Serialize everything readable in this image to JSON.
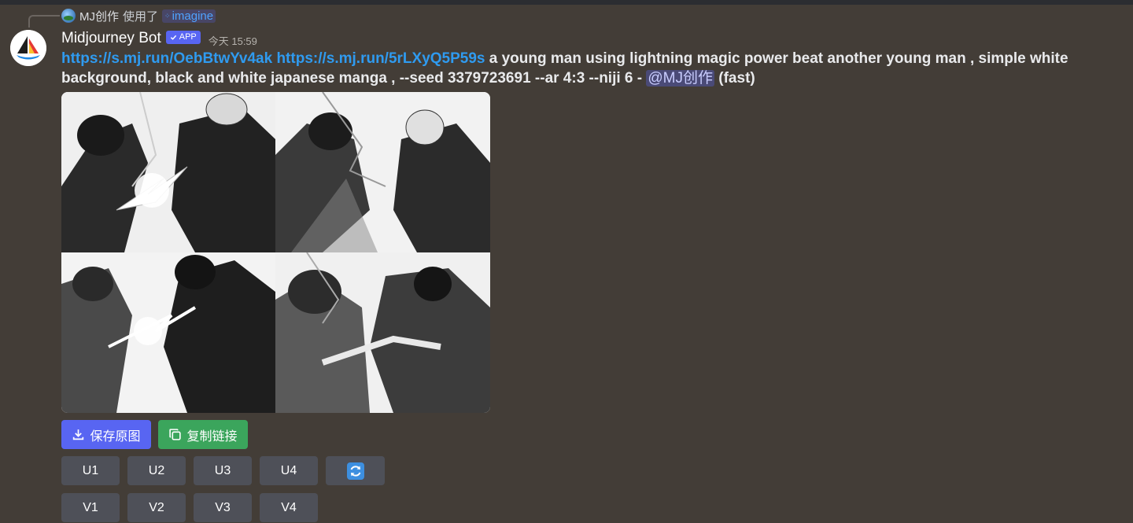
{
  "reply": {
    "user": "MJ创作",
    "used": "使用了",
    "command": "imagine"
  },
  "header": {
    "bot_name": "Midjourney Bot",
    "badge": "APP",
    "timestamp": "今天 15:59"
  },
  "message": {
    "link1": "https://s.mj.run/OebBtwYv4ak",
    "link2": "https://s.mj.run/5rLXyQ5P59s",
    "prompt": " a young man using lightning magic power beat another young man , simple white background, black and white japanese manga , --seed 3379723691 --ar 4:3 --niji 6 - ",
    "mention": "@MJ创作",
    "speed": " (fast)"
  },
  "actions": {
    "save_label": "保存原图",
    "copy_label": "复制链接"
  },
  "upscale_buttons": [
    "U1",
    "U2",
    "U3",
    "U4"
  ],
  "variation_buttons": [
    "V1",
    "V2",
    "V3",
    "V4"
  ],
  "icons": {
    "reroll": "refresh-icon",
    "save": "download-icon",
    "copy": "copy-icon"
  },
  "colors": {
    "background": "#433d37",
    "link": "#2f9bf0",
    "primary": "#5865f2",
    "success": "#3ba55c",
    "gray_button": "#4e5058"
  }
}
